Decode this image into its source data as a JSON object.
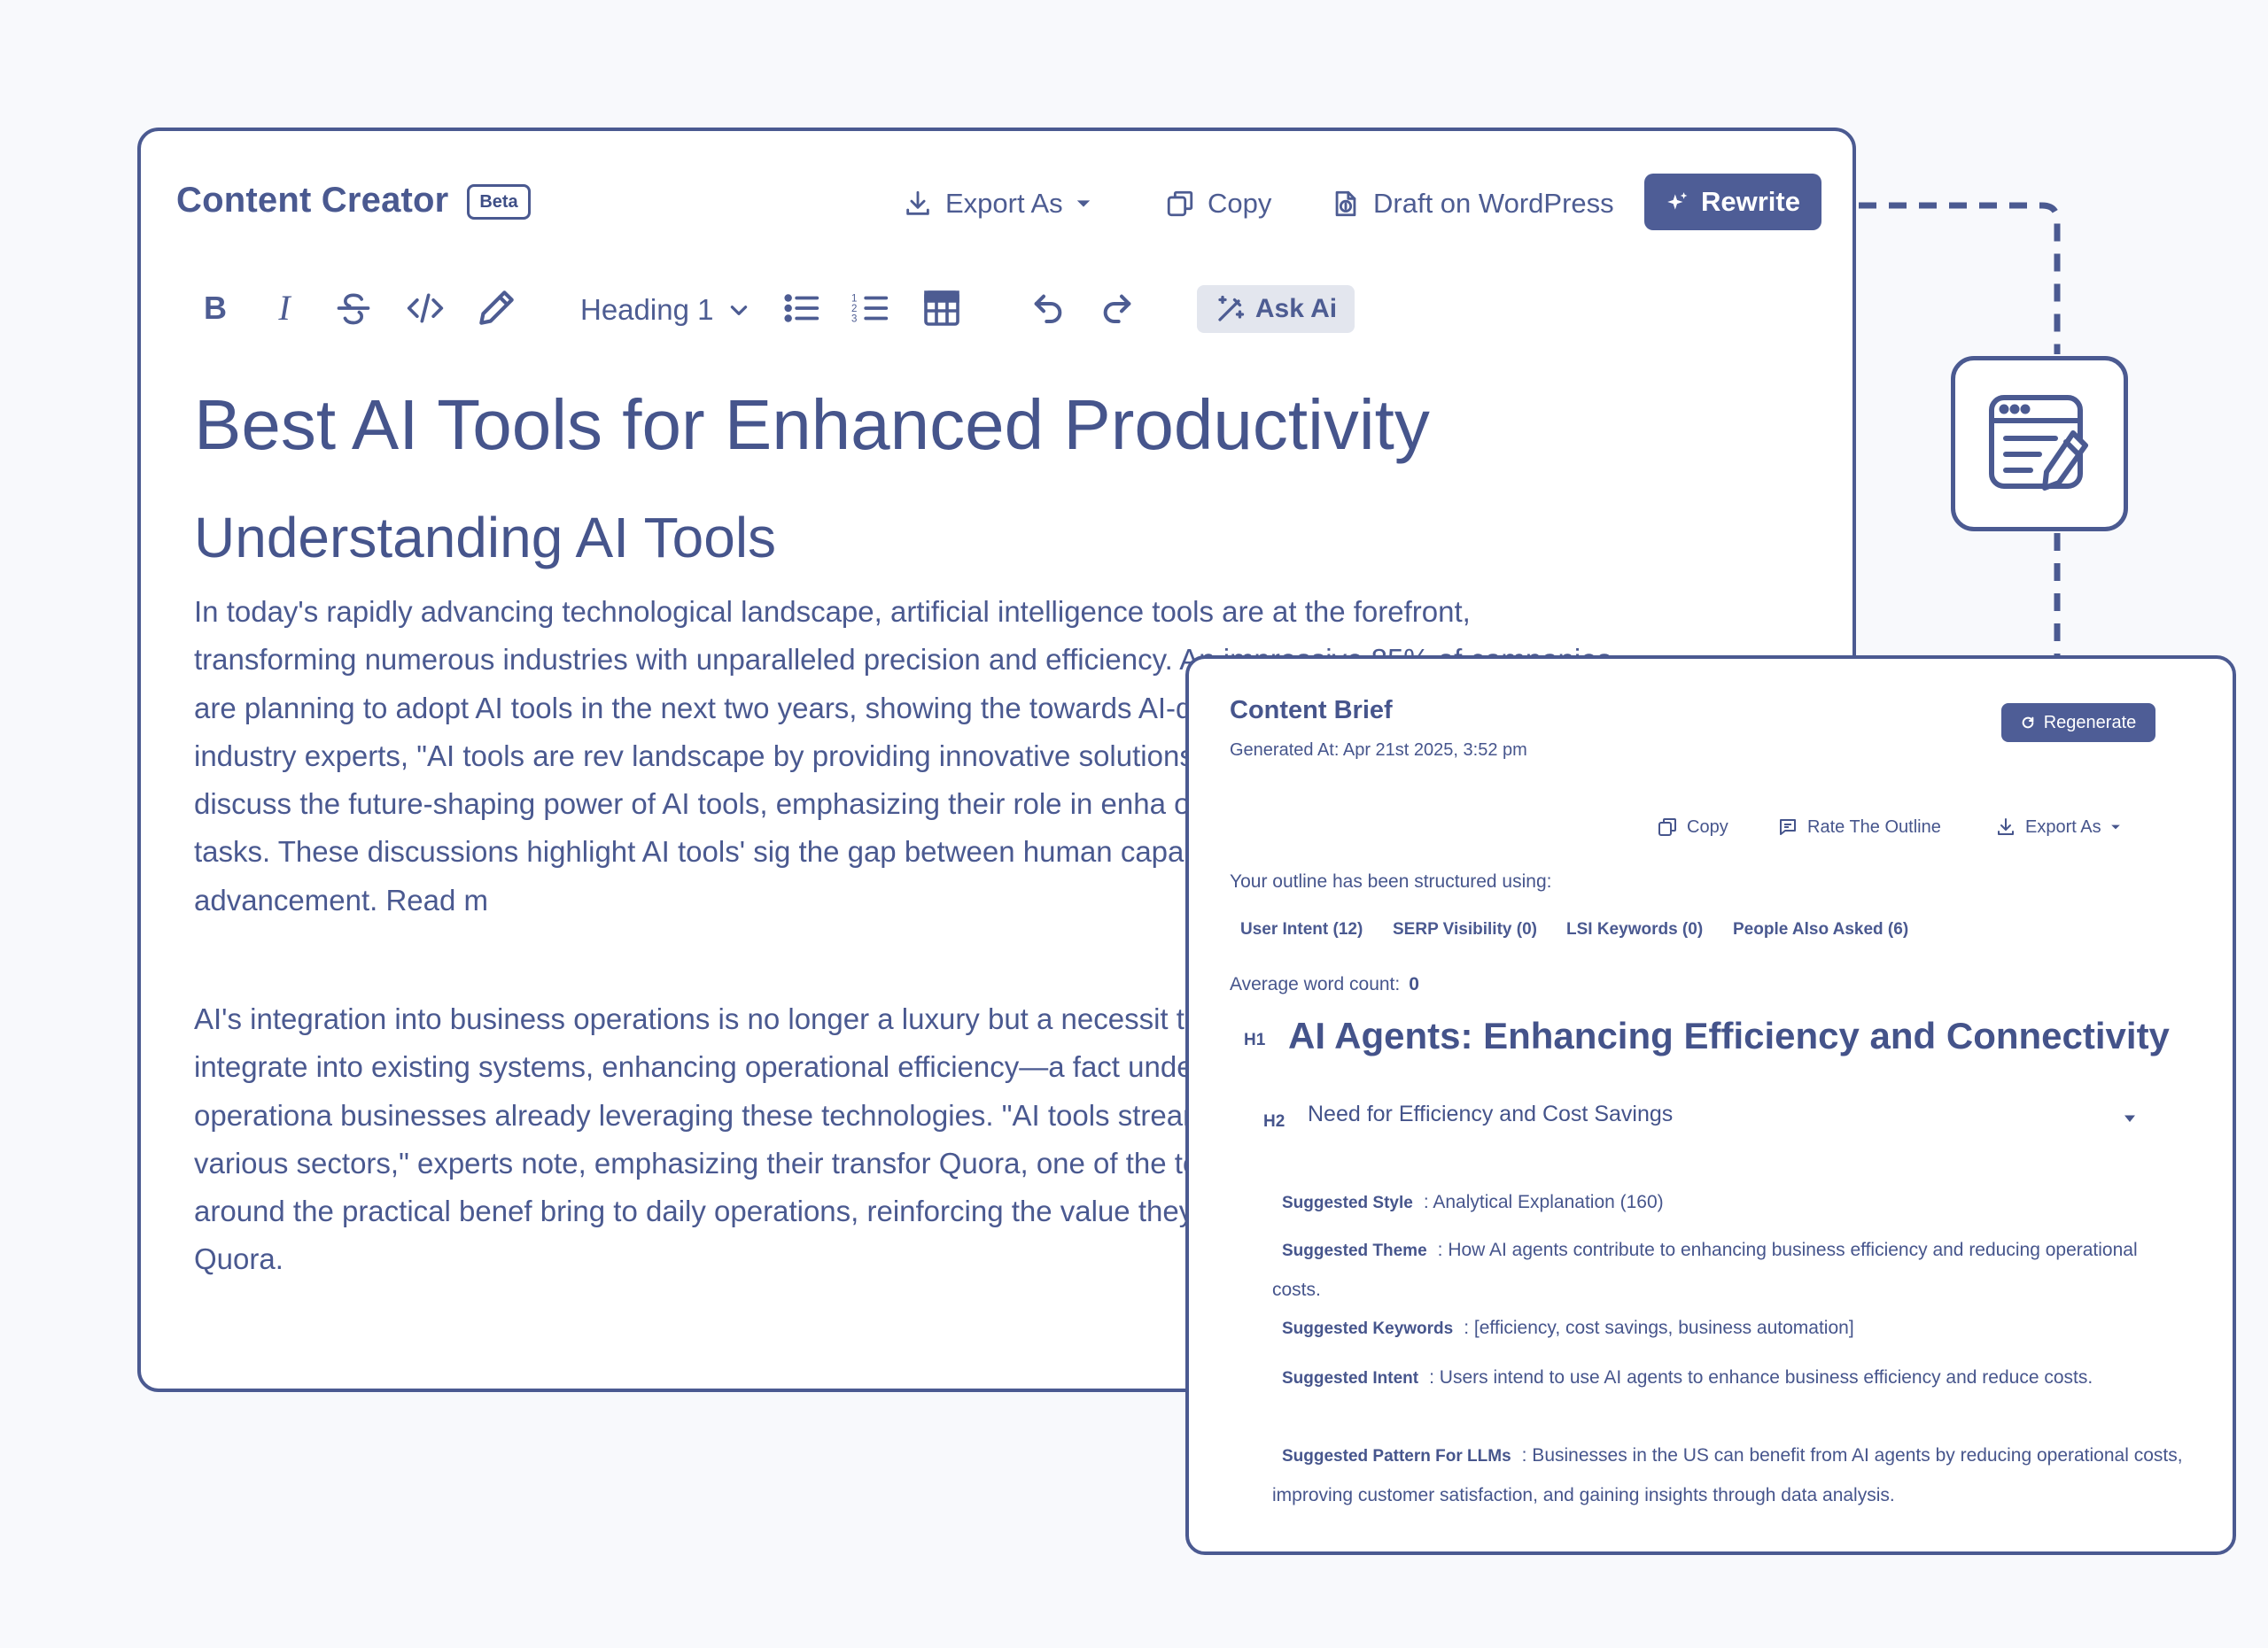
{
  "creator": {
    "title": "Content Creator",
    "badge": "Beta",
    "header": {
      "export_label": "Export As",
      "copy_label": "Copy",
      "draft_label": "Draft on WordPress",
      "rewrite_label": "Rewrite"
    },
    "toolbar": {
      "heading_select": "Heading 1",
      "ask_ai_label": "Ask Ai"
    },
    "document": {
      "h1": "Best AI Tools for Enhanced Productivity",
      "h2": "Understanding AI Tools",
      "p1": "In today's rapidly advancing technological landscape, artificial intelligence tools are at the forefront, transforming numerous industries with unparalleled precision and efficiency. An impressive 85% of companies are planning to adopt AI tools in the next two years, showing the towards AI-driven solutions. According to industry experts, \"AI tools are rev landscape by providing innovative solutions to complex problems.\" On Redd discuss the future-shaping power of AI tools, emphasizing their role in enha operations but also everyday tasks. These discussions highlight AI tools' sig the gap between human capability and technological advancement. Read m",
      "p2": "AI's integration into business operations is no longer a luxury but a necessit tools allows them to seamlessly integrate into existing systems, enhancing operational efficiency—a fact underscored by a 30% increase in operationa businesses already leveraging these technologies. \"AI tools streamline oper resources across various sectors,\" experts note, emphasizing their transfor Quora, one of the top discussion points revolves around the practical benef bring to daily operations, reinforcing the value they add by elevating busine more on Quora."
    }
  },
  "brief": {
    "title": "Content Brief",
    "generated": "Generated At: Apr 21st 2025, 3:52 pm",
    "regenerate_label": "Regenerate",
    "actions": {
      "copy": "Copy",
      "rate": "Rate The Outline",
      "export": "Export As"
    },
    "structured_label": "Your outline has been structured using:",
    "chips": [
      "User Intent (12)",
      "SERP Visibility (0)",
      "LSI Keywords (0)",
      "People Also Asked (6)"
    ],
    "avg_label": "Average word count:",
    "avg_value": "0",
    "h1_tag": "H1",
    "h1": "AI Agents: Enhancing Efficiency and Connectivity",
    "h2_tag": "H2",
    "h2": "Need for Efficiency and Cost Savings",
    "suggestions": {
      "style_key": "Suggested Style",
      "style_val": ": Analytical Explanation (160)",
      "theme_key": "Suggested Theme",
      "theme_val": ": How AI agents contribute to enhancing business efficiency and reducing operational costs.",
      "keywords_key": "Suggested Keywords",
      "keywords_val": ": [efficiency, cost savings, business automation]",
      "intent_key": "Suggested Intent",
      "intent_val": ": Users intend to use AI agents to enhance business efficiency and reduce costs.",
      "pattern_key": "Suggested Pattern For LLMs",
      "pattern_val": ": Businesses in the US can benefit from AI agents by reducing operational costs, improving customer satisfaction, and gaining insights through data analysis."
    }
  },
  "colors": {
    "primary": "#4e5d96",
    "border": "#4b5a91",
    "text": "#46558c",
    "background": "#f8f9fc",
    "ask_ai_bg": "#e3e6ee"
  },
  "icons": [
    "download-icon",
    "chevron-down-icon",
    "copy-icon",
    "wordpress-upload-icon",
    "sparkle-icon",
    "bold-icon",
    "italic-icon",
    "strikethrough-icon",
    "code-icon",
    "pen-icon",
    "bullet-list-icon",
    "numbered-list-icon",
    "table-icon",
    "undo-icon",
    "redo-icon",
    "magic-wand-icon",
    "document-edit-icon",
    "refresh-icon",
    "message-icon",
    "caret-down-icon"
  ]
}
